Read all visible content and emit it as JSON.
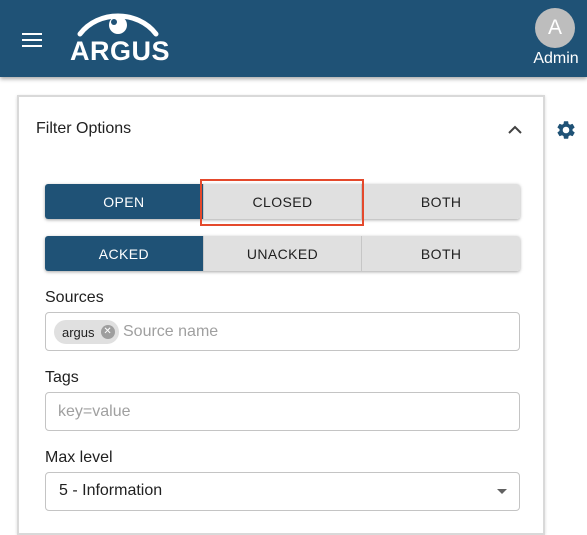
{
  "app": {
    "logo_text": "ARGUS",
    "user_initial": "A",
    "user_name": "Admin",
    "brand_color": "#1f5276"
  },
  "filter_panel": {
    "title": "Filter Options",
    "open_state": {
      "options": [
        "OPEN",
        "CLOSED",
        "BOTH"
      ],
      "selected": "OPEN"
    },
    "ack_state": {
      "options": [
        "ACKED",
        "UNACKED",
        "BOTH"
      ],
      "selected": "ACKED"
    },
    "sources": {
      "label": "Sources",
      "chips": [
        "argus"
      ],
      "placeholder": "Source name"
    },
    "tags": {
      "label": "Tags",
      "placeholder": "key=value"
    },
    "max_level": {
      "label": "Max level",
      "value": "5 - Information"
    }
  },
  "icons": {
    "menu": "menu-icon",
    "collapse": "chevron-up-icon",
    "settings": "gear-icon",
    "chip_remove": "close-circle-icon"
  },
  "highlight_color": "#e4492c"
}
